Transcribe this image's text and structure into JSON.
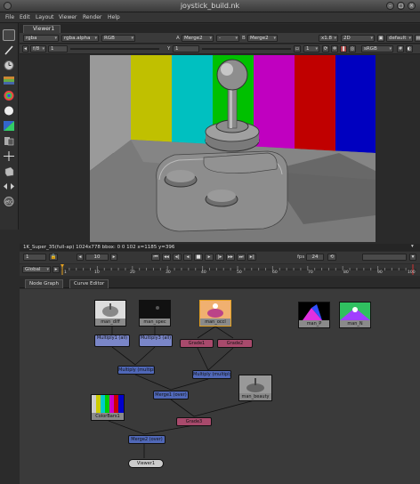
{
  "window": {
    "title": "joystick_build.nk"
  },
  "menu": [
    "File",
    "Edit",
    "Layout",
    "Viewer",
    "Render",
    "Help"
  ],
  "viewer": {
    "tab_label": "Viewer1",
    "channels": "rgba",
    "alpha_channel": "rgba.alpha",
    "display": "RGB",
    "a_label": "A",
    "a_input": "Merge2",
    "compare_dash": "-",
    "b_label": "B",
    "b_input": "Merge2",
    "zoom": "x1.8",
    "view_mode": "2D",
    "lut_default": "default",
    "frame_f": "f/8",
    "gain_value": "1",
    "y_label": "Y",
    "gamma_value": "1",
    "proxy_value": "1",
    "lut": "sRGB",
    "status_text": "1K_Super_35(full-ap) 1024x778  bbox: 0 0 102  x=1185 y=396",
    "playback_frame": "1",
    "fps_label": "fps",
    "fps_value": "24",
    "step_value": "10",
    "global_label": "Global",
    "timeline_ticks": [
      "1",
      "10",
      "20",
      "30",
      "40",
      "50",
      "60",
      "70",
      "80",
      "90",
      "100"
    ]
  },
  "panel_tabs": {
    "node_graph": "Node Graph",
    "curve_editor": "Curve Editor"
  },
  "nodes": {
    "man_diff": "man_diff",
    "man_spec": "man_spec",
    "man_occl": "man_occl",
    "man_p": "man_P",
    "man_n": "man_N",
    "multiply1": "Multiply1 (all)",
    "multiply3": "Multiply3 (all)",
    "grade1": "Grade1",
    "grade2": "Grade2",
    "multiply_mult1": "Multiply (multiply)",
    "multiply_mult2": "Multiply (multiply)",
    "merge1": "Merge1 (over)",
    "man_beauty": "man_beauty",
    "color_bars": "ColorBars1",
    "grade3": "Grade3",
    "merge2": "Merge2 (over)",
    "viewer1": "Viewer1"
  },
  "colors": {
    "read_node": "#8a8a8a",
    "multiply_node": "#7a86c8",
    "grade_node": "#a84a6c",
    "merge_node": "#5068b8",
    "viewer_node": "#cccccc",
    "timeline_marker": "#e3a020"
  },
  "icons": [
    "toolbar-select-icon",
    "toolbar-paint-icon",
    "toolbar-time-icon",
    "toolbar-channel-icon",
    "toolbar-color-icon",
    "toolbar-filter-icon",
    "toolbar-keyer-icon",
    "toolbar-merge-icon",
    "toolbar-transform-icon",
    "toolbar-3d-icon",
    "toolbar-views-icon",
    "toolbar-other-icon",
    "play-forward-icon",
    "play-back-icon",
    "stop-icon",
    "lock-icon"
  ]
}
